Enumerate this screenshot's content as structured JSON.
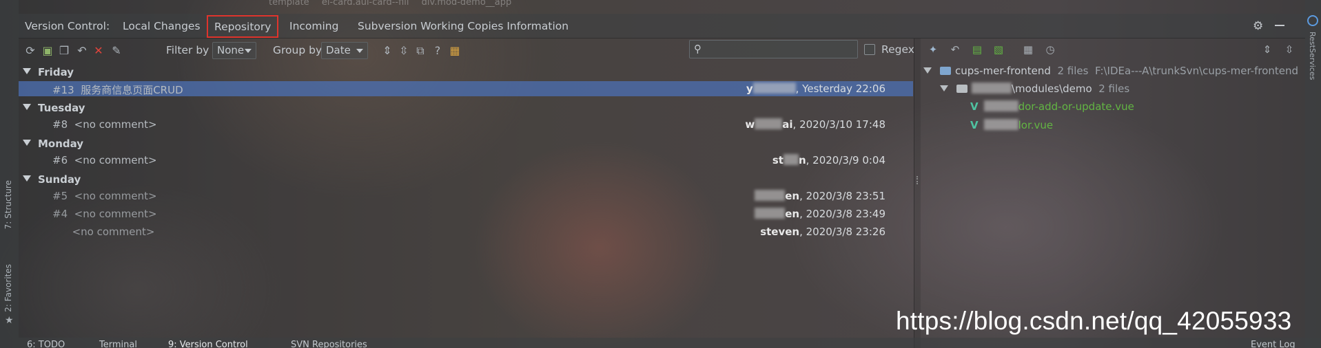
{
  "breadcrumbs": [
    "template",
    "el-card.aui-card--fill",
    "div.mod-demo__app"
  ],
  "tool_window": {
    "prefix_label": "Version Control:",
    "tabs": [
      {
        "label": "Local Changes",
        "active": false
      },
      {
        "label": "Repository",
        "active": true
      },
      {
        "label": "Incoming",
        "active": false
      },
      {
        "label": "Subversion Working Copies Information",
        "active": false
      }
    ],
    "highlight_color": "#e0342c"
  },
  "toolbar": {
    "filter_label": "Filter by",
    "filter_value": "None",
    "group_label": "Group by",
    "group_value": "Date",
    "search_placeholder": "",
    "regex_label": "Regex",
    "regex_checked": false
  },
  "changes": {
    "groups": [
      {
        "name": "Friday",
        "items": [
          {
            "rev": "#13",
            "comment": "服务商信息页面CRUD",
            "author_visible": "y",
            "date": ", Yesterday 22:06",
            "selected": true
          }
        ]
      },
      {
        "name": "Tuesday",
        "items": [
          {
            "rev": "#8",
            "comment": "<no comment>",
            "author_visible": "w",
            "author_suffix": "ai",
            "date": ", 2020/3/10 17:48",
            "selected": false
          }
        ]
      },
      {
        "name": "Monday",
        "items": [
          {
            "rev": "#6",
            "comment": "<no comment>",
            "author_visible": "st",
            "author_suffix": "n",
            "date": ", 2020/3/9 0:04",
            "selected": false
          }
        ]
      },
      {
        "name": "Sunday",
        "items": [
          {
            "rev": "#5",
            "comment": "<no comment>",
            "author_visible": "",
            "author_suffix": "en",
            "date": ", 2020/3/8 23:51",
            "selected": false
          },
          {
            "rev": "#4",
            "comment": "<no comment>",
            "author_visible": "",
            "author_suffix": "en",
            "date": ", 2020/3/8 23:49",
            "selected": false
          },
          {
            "rev": "",
            "comment": "<no comment>",
            "author_visible": "steven",
            "author_suffix": "",
            "date": ", 2020/3/8 23:26",
            "selected": false
          }
        ]
      }
    ],
    "selected_color": "#4b6eaf"
  },
  "details": {
    "root": {
      "name": "cups-mer-frontend",
      "count": "2 files",
      "path": "F:\\IDEa---A\\trunkSvn\\cups-mer-frontend"
    },
    "module": {
      "name": "\\modules\\demo",
      "count": "2 files"
    },
    "files": [
      {
        "name": "dor-add-or-update.vue"
      },
      {
        "name": "lor.vue"
      }
    ],
    "file_color": "#62b543"
  },
  "side_tabs": {
    "left": [
      "7: Structure",
      "2: Favorites"
    ],
    "right": [
      "RestServices"
    ]
  },
  "bottom_tabs": [
    {
      "label": "6: TODO",
      "active": false
    },
    {
      "label": "Terminal",
      "active": false
    },
    {
      "label": "9: Version Control",
      "active": true
    },
    {
      "label": "SVN Repositories",
      "active": false
    },
    {
      "label": "Event Log",
      "active": false
    }
  ],
  "watermark": "https://blog.csdn.net/qq_42055933"
}
